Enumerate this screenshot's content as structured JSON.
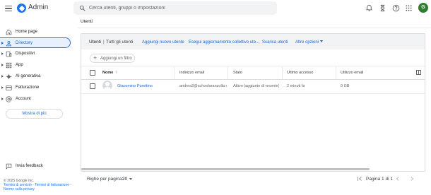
{
  "app": {
    "brand": "Admin",
    "search_placeholder": "Cerca utenti, gruppi o impostazioni",
    "avatar_initial": "G"
  },
  "sidebar": {
    "items": [
      {
        "label": "Home page",
        "icon": "home-icon"
      },
      {
        "label": "Directory",
        "icon": "person-icon",
        "active": true
      },
      {
        "label": "Dispositivi",
        "icon": "devices-icon"
      },
      {
        "label": "App",
        "icon": "apps-grid-icon"
      },
      {
        "label": "AI generativa",
        "icon": "sparkle-icon"
      },
      {
        "label": "Fatturazione",
        "icon": "credit-card-icon"
      },
      {
        "label": "Account",
        "icon": "at-sign-icon"
      }
    ],
    "more_label": "Mostra di più",
    "feedback_label": "Invia feedback",
    "footer": {
      "copyright": "© 2025 Google Inc.",
      "terms": "Termini di servizio",
      "sep1": " - ",
      "billing_terms": "Termini di fatturazione",
      "sep2": " - ",
      "privacy": "Norme sulla privacy"
    }
  },
  "main": {
    "page_title": "Utenti",
    "breadcrumb": {
      "main": "Utenti",
      "sep": "|",
      "sub": "Tutti gli utenti"
    },
    "actions": [
      "Aggiungi nuovo utente",
      "Esegui aggiornamento collettivo ute...",
      "Scarica utenti",
      "Altre opzioni"
    ],
    "filter_label": "Aggiungi un filtro",
    "columns": [
      "Nome",
      "Indirizzo email",
      "Stato",
      "Ultimo accesso",
      "Utilizzo email"
    ],
    "rows": [
      {
        "name": "Giacomino Porettino",
        "email": "andrea2@schoolaranzulla.c...",
        "status": "Attivo (aggiunto di recente)",
        "last_login": "2 minuti fa",
        "email_usage": "0 GB"
      }
    ],
    "pager": {
      "rows_label": "Righe per pagina:",
      "rows_value": "20",
      "page_info": "Pagina 1 di 1"
    }
  },
  "colors": {
    "accent": "#1a73e8",
    "link": "#1967d2",
    "avatar_bg": "#2e7d32",
    "active_bg": "#e8f0fe"
  }
}
